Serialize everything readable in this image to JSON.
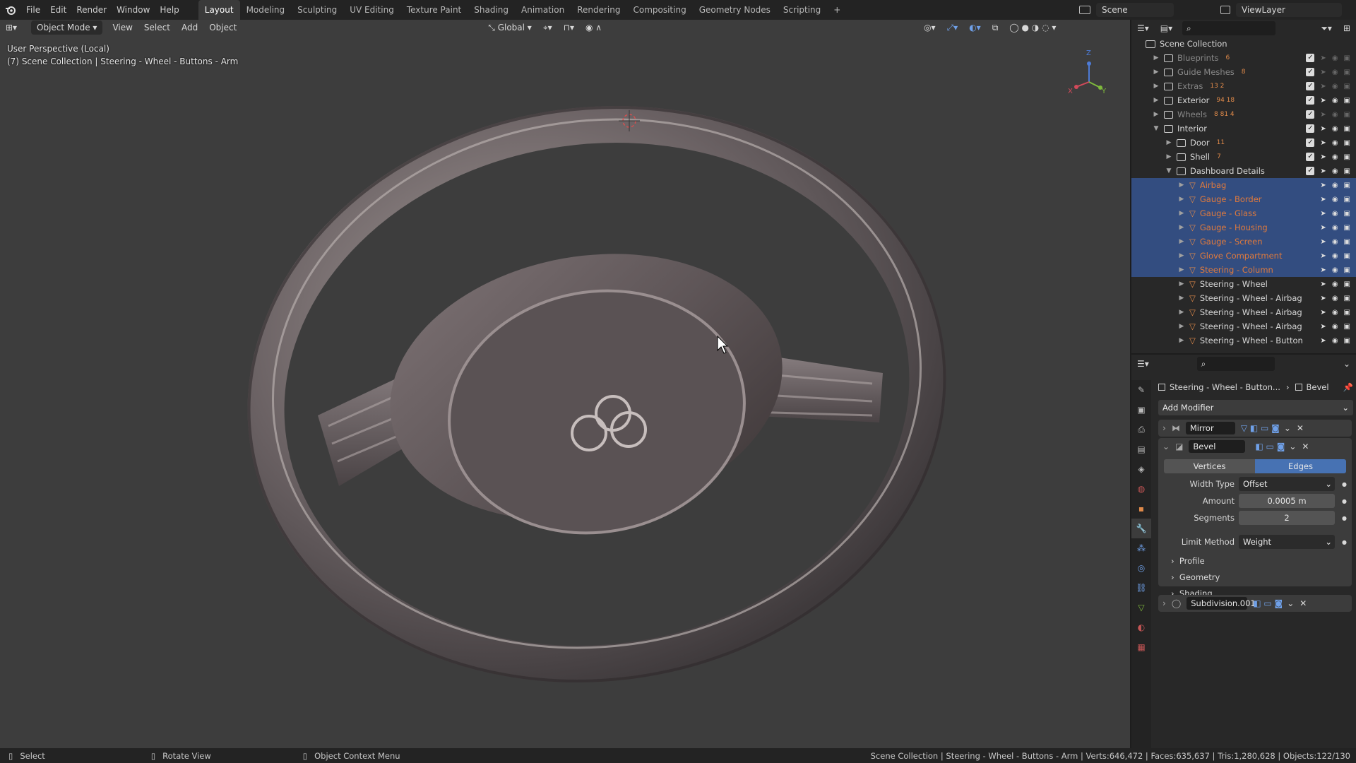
{
  "menu": [
    "File",
    "Edit",
    "Render",
    "Window",
    "Help"
  ],
  "workspaces": [
    "Layout",
    "Modeling",
    "Sculpting",
    "UV Editing",
    "Texture Paint",
    "Shading",
    "Animation",
    "Rendering",
    "Compositing",
    "Geometry Nodes",
    "Scripting"
  ],
  "active_workspace": "Layout",
  "scene_name": "Scene",
  "view_layer": "ViewLayer",
  "viewport": {
    "mode": "Object Mode",
    "menus": [
      "View",
      "Select",
      "Add",
      "Object"
    ],
    "transform_orientation": "Global",
    "perspective_label": "User Perspective (Local)",
    "context_label": "(7) Scene Collection | Steering - Wheel - Buttons - Arm",
    "gizmo_x": "X",
    "gizmo_y": "Y",
    "gizmo_z": "Z"
  },
  "outliner": {
    "root": "Scene Collection",
    "rows": [
      {
        "label": "Blueprints",
        "badge": "6",
        "dim": true
      },
      {
        "label": "Guide Meshes",
        "badge": "8",
        "dim": true
      },
      {
        "label": "Extras",
        "badge": "13 2",
        "dim": true
      },
      {
        "label": "Exterior",
        "badge": "94 18",
        "dim": false
      },
      {
        "label": "Wheels",
        "badge": "8 81 4",
        "dim": true
      },
      {
        "label": "Interior",
        "badge": "",
        "dim": false
      },
      {
        "label": "Door",
        "badge": "11",
        "dim": false
      },
      {
        "label": "Shell",
        "badge": "7",
        "dim": false
      },
      {
        "label": "Dashboard Details",
        "badge": "",
        "dim": false
      },
      {
        "label": "Airbag",
        "badge": "",
        "dim": false
      },
      {
        "label": "Gauge - Border",
        "badge": "",
        "dim": false
      },
      {
        "label": "Gauge - Glass",
        "badge": "",
        "dim": false
      },
      {
        "label": "Gauge - Housing",
        "badge": "",
        "dim": false
      },
      {
        "label": "Gauge - Screen",
        "badge": "",
        "dim": false
      },
      {
        "label": "Glove Compartment",
        "badge": "",
        "dim": false
      },
      {
        "label": "Steering - Column",
        "badge": "",
        "dim": false
      },
      {
        "label": "Steering - Wheel",
        "badge": "",
        "dim": false
      },
      {
        "label": "Steering - Wheel - Airbag",
        "badge": "",
        "dim": false
      },
      {
        "label": "Steering - Wheel - Airbag",
        "badge": "",
        "dim": false
      },
      {
        "label": "Steering - Wheel - Airbag",
        "badge": "",
        "dim": false
      },
      {
        "label": "Steering - Wheel - Button",
        "badge": "",
        "dim": false
      }
    ]
  },
  "properties": {
    "breadcrumb_object": "Steering - Wheel - Button...",
    "breadcrumb_modifier": "Bevel",
    "add_modifier": "Add Modifier",
    "modifiers": [
      "Mirror",
      "Bevel",
      "Subdivision.001"
    ],
    "bevel": {
      "affect_vertices": "Vertices",
      "affect_edges": "Edges",
      "width_type_label": "Width Type",
      "width_type_value": "Offset",
      "amount_label": "Amount",
      "amount_value": "0.0005 m",
      "segments_label": "Segments",
      "segments_value": "2",
      "limit_method_label": "Limit Method",
      "limit_method_value": "Weight",
      "sections": [
        "Profile",
        "Geometry",
        "Shading"
      ]
    }
  },
  "status": {
    "select": "Select",
    "rotate": "Rotate View",
    "context_menu": "Object Context Menu",
    "info": "Scene Collection | Steering - Wheel - Buttons - Arm | Verts:646,472 | Faces:635,637 | Tris:1,280,628 | Objects:122/130"
  },
  "colors": {
    "accent_blue": "#4772b3",
    "selected_orange": "#e07a3c",
    "selection_bg": "#334d80",
    "mesh_icon": "#e08a4a"
  }
}
